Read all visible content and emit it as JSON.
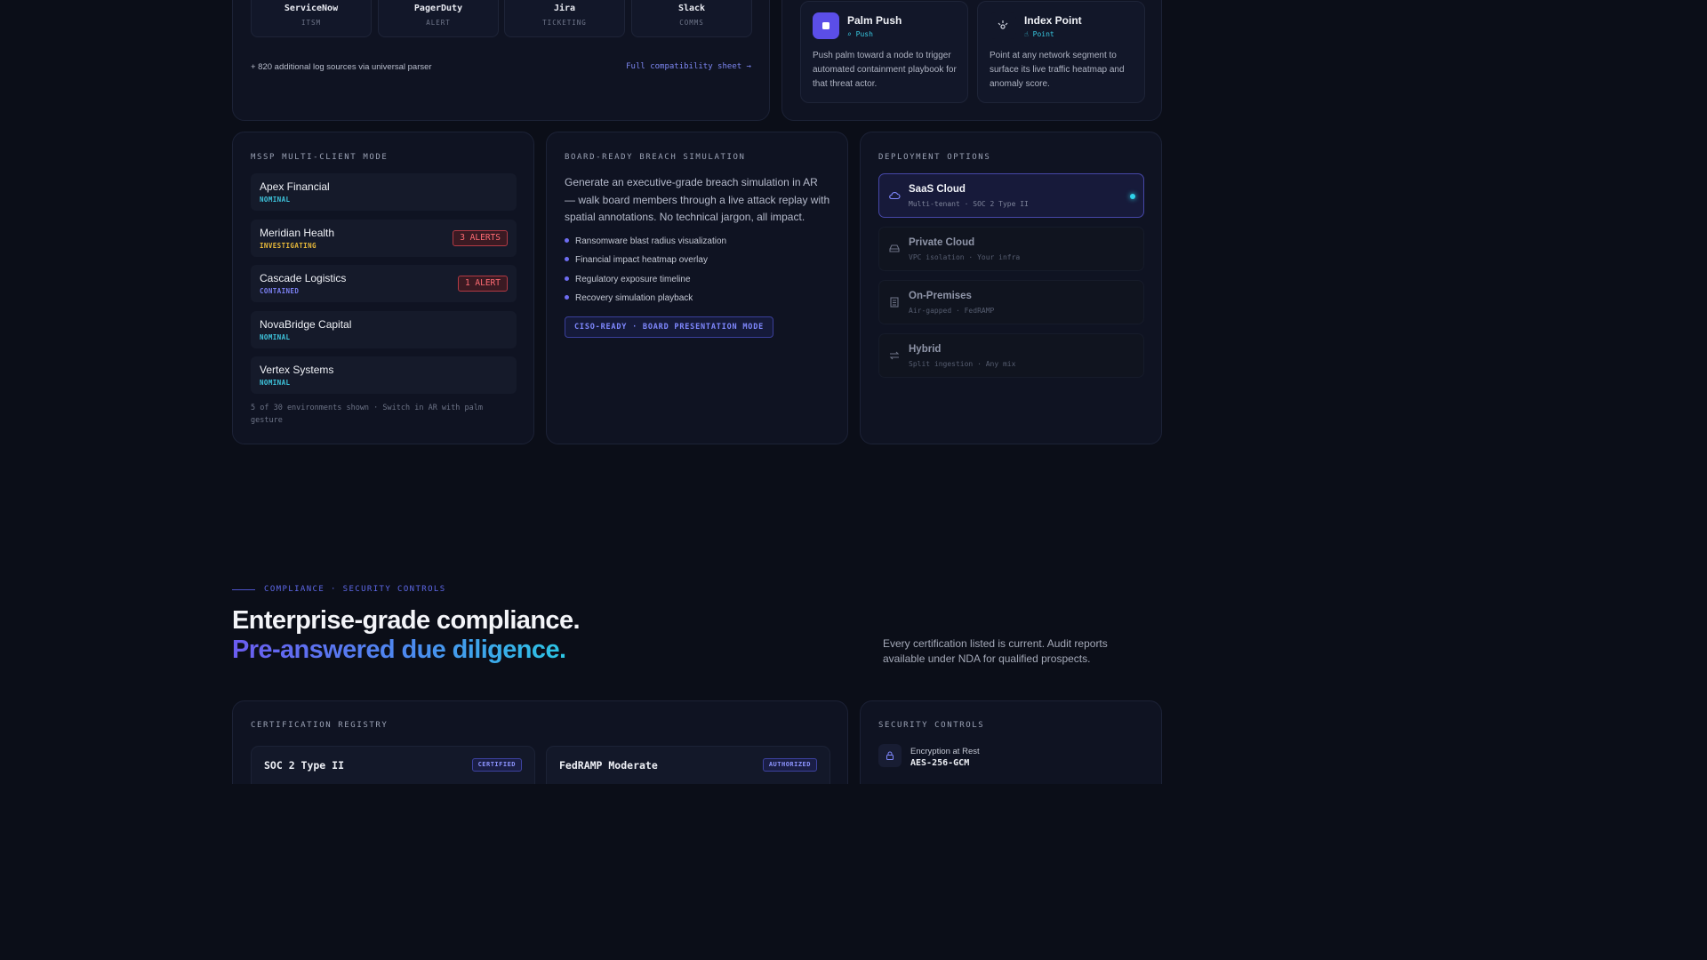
{
  "integrations": {
    "tiles": [
      {
        "name": "ServiceNow",
        "type": "ITSM"
      },
      {
        "name": "PagerDuty",
        "type": "ALERT"
      },
      {
        "name": "Jira",
        "type": "TICKETING"
      },
      {
        "name": "Slack",
        "type": "COMMS"
      }
    ],
    "footnote": "+ 820 additional log sources via universal parser",
    "link_label": "Full compatibility sheet →"
  },
  "gestures": [
    {
      "title": "Palm Push",
      "tag": "⌕ Push",
      "description": "Push palm toward a node to trigger automated containment playbook for that threat actor.",
      "icon": "palm-push-icon"
    },
    {
      "title": "Index Point",
      "tag": "☝ Point",
      "description": "Point at any network segment to surface its live traffic heatmap and anomaly score.",
      "icon": "index-point-icon"
    }
  ],
  "mssp": {
    "label": "MSSP MULTI-CLIENT MODE",
    "clients": [
      {
        "name": "Apex Financial",
        "status": "NOMINAL",
        "status_color": "#3ec4dc",
        "alerts": ""
      },
      {
        "name": "Meridian Health",
        "status": "INVESTIGATING",
        "status_color": "#e8b93a",
        "alerts": "3 ALERTS"
      },
      {
        "name": "Cascade Logistics",
        "status": "CONTAINED",
        "status_color": "#7a7ff0",
        "alerts": "1 ALERT"
      },
      {
        "name": "NovaBridge Capital",
        "status": "NOMINAL",
        "status_color": "#3ec4dc",
        "alerts": ""
      },
      {
        "name": "Vertex Systems",
        "status": "NOMINAL",
        "status_color": "#3ec4dc",
        "alerts": ""
      }
    ],
    "footnote": "5 of 30 environments shown · Switch in AR with palm gesture"
  },
  "board": {
    "label": "BOARD-READY BREACH SIMULATION",
    "description": "Generate an executive-grade breach simulation in AR — walk board members through a live attack replay with spatial annotations. No technical jargon, all impact.",
    "bullets": [
      "Ransomware blast radius visualization",
      "Financial impact heatmap overlay",
      "Regulatory exposure timeline",
      "Recovery simulation playback"
    ],
    "badge": "CISO-READY · BOARD PRESENTATION MODE"
  },
  "deployment": {
    "label": "DEPLOYMENT OPTIONS",
    "options": [
      {
        "name": "SaaS Cloud",
        "detail": "Multi-tenant · SOC 2 Type II",
        "icon": "cloud-icon",
        "active": true
      },
      {
        "name": "Private Cloud",
        "detail": "VPC isolation · Your infra",
        "icon": "server-icon",
        "active": false
      },
      {
        "name": "On-Premises",
        "detail": "Air-gapped · FedRAMP",
        "icon": "building-icon",
        "active": false
      },
      {
        "name": "Hybrid",
        "detail": "Split ingestion · Any mix",
        "icon": "swap-arrows-icon",
        "active": false
      }
    ]
  },
  "compliance": {
    "eyebrow": "COMPLIANCE · SECURITY CONTROLS",
    "headline_1": "Enterprise-grade compliance.",
    "headline_2": "Pre-answered due diligence.",
    "note": "Every certification listed is current. Audit reports available under NDA for qualified prospects.",
    "registry_label": "CERTIFICATION REGISTRY",
    "certs": [
      {
        "name": "SOC 2 Type II",
        "badge": "CERTIFIED"
      },
      {
        "name": "FedRAMP Moderate",
        "badge": "AUTHORIZED"
      }
    ],
    "controls_label": "SECURITY CONTROLS",
    "controls": [
      {
        "name": "Encryption at Rest",
        "value": "AES-256-GCM",
        "icon": "lock-icon"
      }
    ]
  },
  "colors": {
    "background": "#0b0e18",
    "accent": "#5e68e8",
    "cyan": "#2fd3ea",
    "alert": "#ff6b73"
  }
}
